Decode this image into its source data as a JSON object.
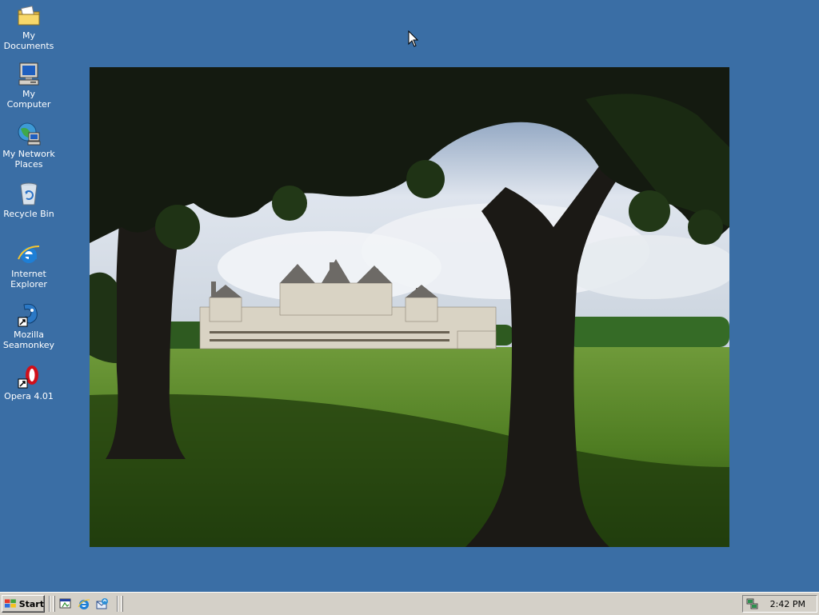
{
  "desktop": {
    "background_color": "#3a6ea5",
    "icons": [
      {
        "label": "My Documents",
        "icon": "folder-documents-icon"
      },
      {
        "label": "My Computer",
        "icon": "computer-icon"
      },
      {
        "label": "My Network Places",
        "icon": "network-places-icon"
      },
      {
        "label": "Recycle Bin",
        "icon": "recycle-bin-icon"
      },
      {
        "label": "Internet Explorer",
        "icon": "internet-explorer-icon"
      },
      {
        "label": "Mozilla Seamonkey",
        "icon": "seamonkey-icon"
      },
      {
        "label": "Opera 4.01",
        "icon": "opera-icon"
      }
    ],
    "wallpaper": "chateau-de-chambord-photo"
  },
  "taskbar": {
    "start_label": "Start",
    "quick_launch": [
      {
        "icon": "show-desktop-icon"
      },
      {
        "icon": "internet-explorer-icon"
      },
      {
        "icon": "outlook-express-icon"
      }
    ],
    "tray": {
      "icon": "network-tray-icon",
      "clock": "2:42 PM"
    }
  }
}
